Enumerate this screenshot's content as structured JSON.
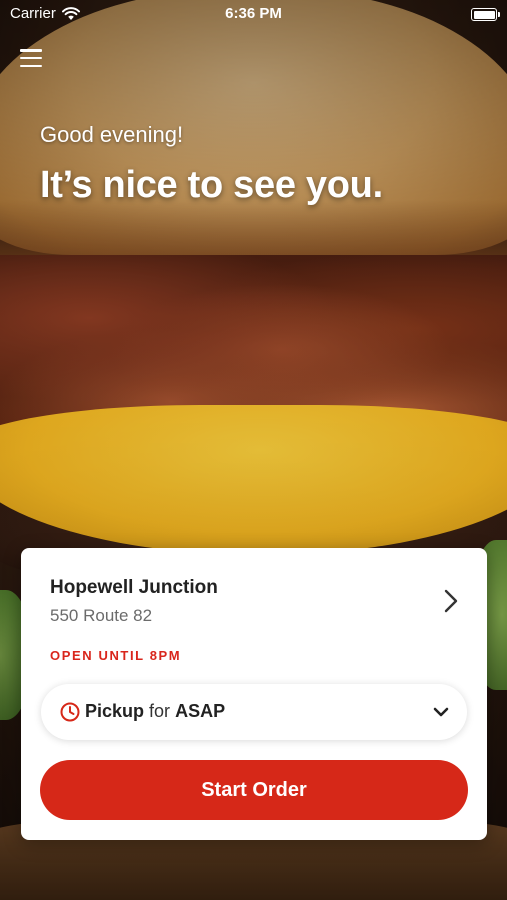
{
  "status_bar": {
    "carrier": "Carrier",
    "time": "6:36 PM",
    "battery_level": 1.0
  },
  "header": {
    "menu_icon": "hamburger-menu-icon",
    "greeting": "Good evening!",
    "headline": "It’s nice to see you."
  },
  "location_card": {
    "name": "Hopewell Junction",
    "address": "550 Route 82",
    "open_status": "OPEN UNTIL 8PM",
    "chevron_icon": "chevron-right-icon",
    "order_type": {
      "icon": "clock-icon",
      "mode": "Pickup",
      "connector": "for",
      "time": "ASAP",
      "dropdown_icon": "chevron-down-icon"
    },
    "start_order_label": "Start Order"
  },
  "colors": {
    "accent": "#d62818",
    "open_status": "#d9261c",
    "card_background": "#ffffff",
    "text_primary": "#222222",
    "text_secondary": "#6b6b6b"
  }
}
